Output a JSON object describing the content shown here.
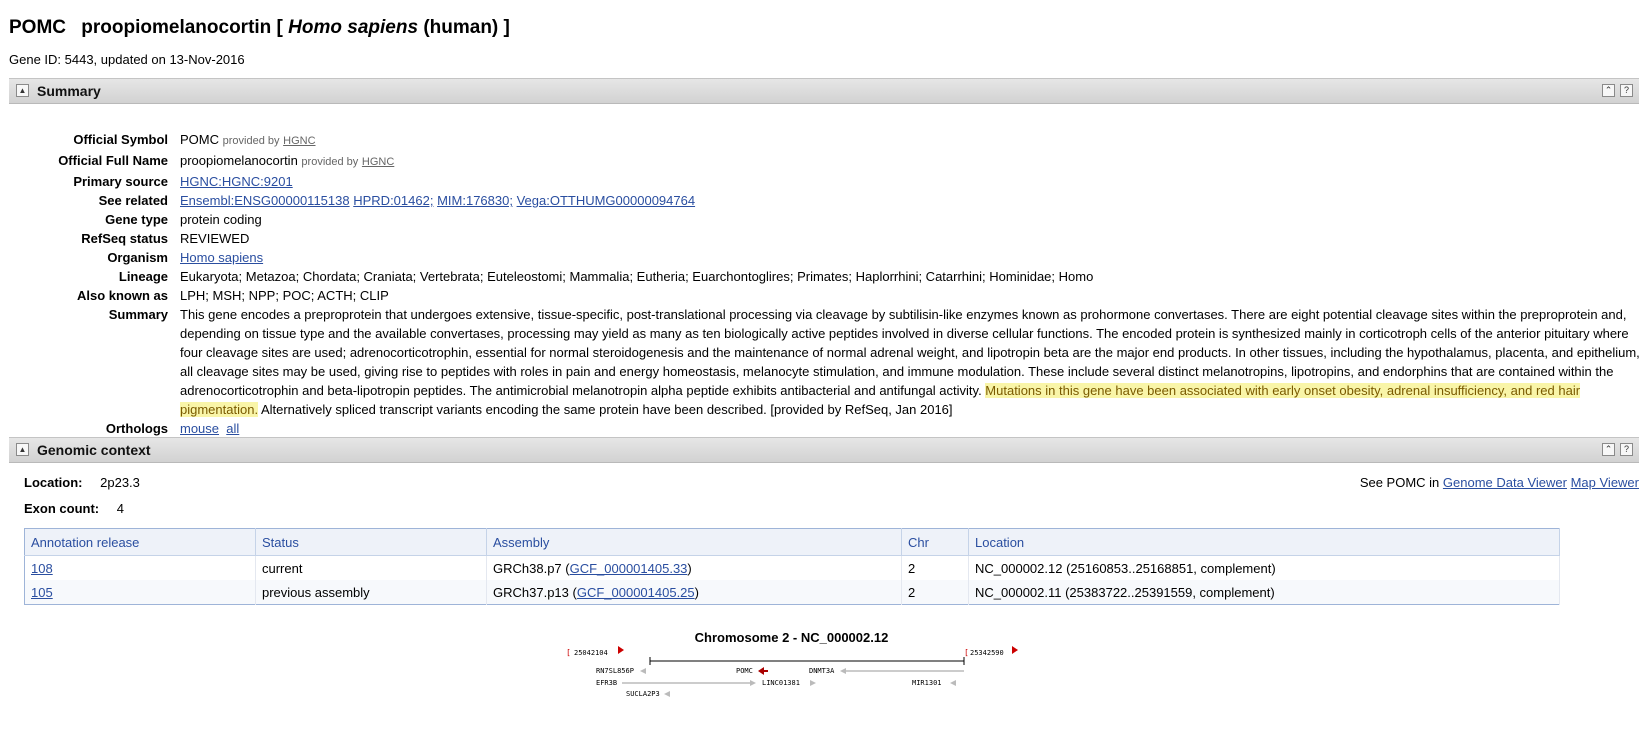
{
  "header": {
    "symbol": "POMC",
    "name_prefix": "proopiomelanocortin [",
    "organism_italic": "Homo sapiens",
    "name_suffix": "(human) ]",
    "gene_id_line": "Gene ID: 5443, updated on 13-Nov-2016"
  },
  "sections": {
    "summary_title": "Summary",
    "genomic_title": "Genomic context",
    "toggle_glyph": "▲",
    "top_glyph": "⌃",
    "help_glyph": "?"
  },
  "summary": {
    "official_symbol_label": "Official Symbol",
    "official_symbol": "POMC",
    "provided_by": "provided by",
    "hgnc": "HGNC",
    "full_name_label": "Official Full Name",
    "full_name": "proopiomelanocortin",
    "primary_source_label": "Primary source",
    "primary_source": "HGNC:HGNC:9201",
    "see_related_label": "See related",
    "see_related": [
      "Ensembl:ENSG00000115138",
      "HPRD:01462;",
      "MIM:176830;",
      "Vega:OTTHUMG00000094764"
    ],
    "gene_type_label": "Gene type",
    "gene_type": "protein coding",
    "refseq_status_label": "RefSeq status",
    "refseq_status": "REVIEWED",
    "organism_label": "Organism",
    "organism": "Homo sapiens",
    "lineage_label": "Lineage",
    "lineage": "Eukaryota; Metazoa; Chordata; Craniata; Vertebrata; Euteleostomi; Mammalia; Eutheria; Euarchontoglires; Primates; Haplorrhini; Catarrhini; Hominidae; Homo",
    "aka_label": "Also known as",
    "aka": "LPH; MSH; NPP; POC; ACTH; CLIP",
    "summary_label": "Summary",
    "summary_text_1": "This gene encodes a preproprotein that undergoes extensive, tissue-specific, post-translational processing via cleavage by subtilisin-like enzymes known as prohormone convertases. There are eight potential cleavage sites within the preproprotein and, depending on tissue type and the available convertases, processing may yield as many as ten biologically active peptides involved in diverse cellular functions. The encoded protein is synthesized mainly in corticotroph cells of the anterior pituitary where four cleavage sites are used; adrenocorticotrophin, essential for normal steroidogenesis and the maintenance of normal adrenal weight, and lipotropin beta are the major end products. In other tissues, including the hypothalamus, placenta, and epithelium, all cleavage sites may be used, giving rise to peptides with roles in pain and energy homeostasis, melanocyte stimulation, and immune modulation. These include several distinct melanotropins, lipotropins, and endorphins that are contained within the adrenocorticotrophin and beta-lipotropin peptides. The antimicrobial melanotropin alpha peptide exhibits antibacterial and antifungal activity. ",
    "summary_text_highlight": "Mutations in this gene have been associated with early onset obesity, adrenal insufficiency, and red hair pigmentation.",
    "summary_text_2": " Alternatively spliced transcript variants encoding the same protein have been described. [provided by RefSeq, Jan 2016]",
    "orthologs_label": "Orthologs",
    "orthologs": [
      "mouse",
      "all"
    ],
    "highlight_color": "#f9f5a8"
  },
  "genomic": {
    "location_label": "Location:",
    "location": "2p23.3",
    "exon_label": "Exon count:",
    "exon_count": "4",
    "see_prefix": "See POMC in",
    "gdv_link": "Genome Data Viewer",
    "map_link": "Map Viewer",
    "table_headers": [
      "Annotation release",
      "Status",
      "Assembly",
      "Chr",
      "Location"
    ],
    "rows": [
      {
        "release": "108",
        "status": "current",
        "assembly_prefix": "GRCh38.p7 (",
        "assembly_link": "GCF_000001405.33",
        "assembly_suffix": ")",
        "chr": "2",
        "location": "NC_000002.12 (25160853..25168851, complement)"
      },
      {
        "release": "105",
        "status": "previous assembly",
        "assembly_prefix": "GRCh37.p13 (",
        "assembly_link": "GCF_000001405.25",
        "assembly_suffix": ")",
        "chr": "2",
        "location": "NC_000002.11 (25383722..25391559, complement)"
      }
    ]
  },
  "chromosome": {
    "title": "Chromosome 2 - NC_000002.12",
    "left_coord": "25042104",
    "right_coord": "25342590",
    "genes": [
      "RN7SL856P",
      "POMC",
      "DNMT3A",
      "EFR3B",
      "LINC01381",
      "MIR1301",
      "SUCLA2P3"
    ]
  }
}
